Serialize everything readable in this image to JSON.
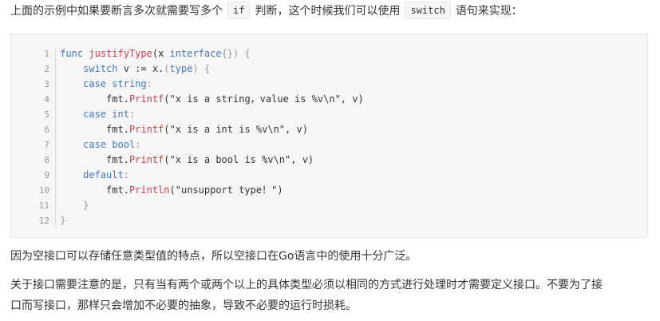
{
  "intro": {
    "before": "上面的示例中如果要断言多次就需要写多个",
    "kw1": "if",
    "middle": "判断，这个时候我们可以使用",
    "kw2": "switch",
    "after": "语句来实现："
  },
  "code": {
    "line_numbers": [
      "1",
      "2",
      "3",
      "4",
      "5",
      "6",
      "7",
      "8",
      "9",
      "10",
      "11",
      "12"
    ],
    "l1": {
      "kw": "func",
      "fn": "justifyType",
      "p1": "(x ",
      "kw2": "interface",
      "p2": "{}) {"
    },
    "l2": {
      "indent": "    ",
      "kw": "switch",
      "rest": " v := x.",
      "p1": "(",
      "kw2": "type",
      "p2": ") {"
    },
    "l3": {
      "indent": "    ",
      "kw": "case",
      "kw2": " string",
      "p": ":"
    },
    "l4": {
      "indent": "        ",
      "obj": "fmt.",
      "fn": "Printf",
      "rest": "(\"x is a string，value is %v\\n\", v)"
    },
    "l5": {
      "indent": "    ",
      "kw": "case",
      "kw2": " int",
      "p": ":"
    },
    "l6": {
      "indent": "        ",
      "obj": "fmt.",
      "fn": "Printf",
      "rest": "(\"x is a int is %v\\n\", v)"
    },
    "l7": {
      "indent": "    ",
      "kw": "case",
      "kw2": " bool",
      "p": ":"
    },
    "l8": {
      "indent": "        ",
      "obj": "fmt.",
      "fn": "Printf",
      "rest": "(\"x is a bool is %v\\n\", v)"
    },
    "l9": {
      "indent": "    ",
      "kw": "default",
      "p": ":"
    },
    "l10": {
      "indent": "        ",
      "obj": "fmt.",
      "fn": "Println",
      "rest": "(\"unsupport type！\")"
    },
    "l11": {
      "indent": "    ",
      "p": "}"
    },
    "l12": {
      "indent": "",
      "p": "}"
    }
  },
  "para2": "因为空接口可以存储任意类型值的特点，所以空接口在Go语言中的使用十分广泛。",
  "para3": {
    "line1": "关于接口需要注意的是，只有当有两个或两个以上的具体类型必须以相同的方式进行处理时才需要定义接口。不要为了接",
    "line2": "口而写接口，那样只会增加不必要的抽象，导致不必要的运行时损耗。"
  }
}
